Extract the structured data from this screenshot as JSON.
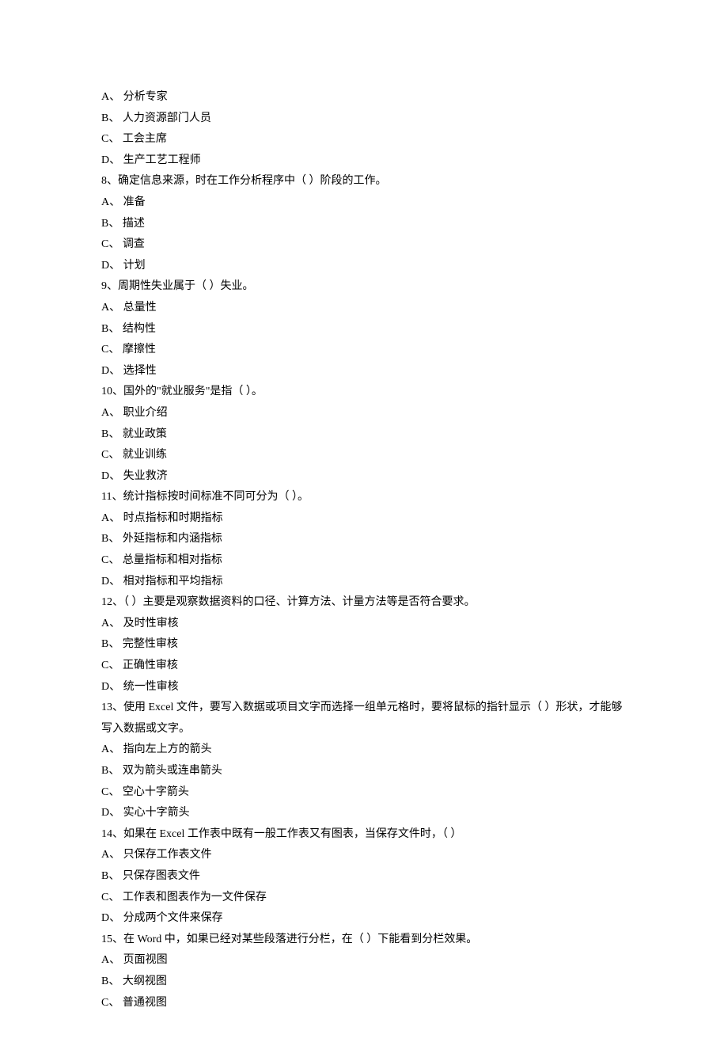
{
  "lines": [
    "A、  分析专家",
    "B、  人力资源部门人员",
    "C、  工会主席",
    "D、  生产工艺工程师",
    "8、确定信息来源，时在工作分析程序中（  ）阶段的工作。",
    "A、  准备",
    "B、  描述",
    "C、  调查",
    "D、  计划",
    "9、周期性失业属于（  ）失业。",
    "A、  总量性",
    "B、  结构性",
    "C、  摩擦性",
    "D、  选择性",
    "10、国外的\"就业服务\"是指（  ）。",
    "A、  职业介绍",
    "B、  就业政策",
    "C、  就业训练",
    "D、  失业救济",
    "11、统计指标按时间标准不同可分为（  ）。",
    "A、  时点指标和时期指标",
    "B、  外延指标和内涵指标",
    "C、  总量指标和相对指标",
    "D、  相对指标和平均指标",
    "12、（  ）主要是观察数据资料的口径、计算方法、计量方法等是否符合要求。",
    "A、  及时性审核",
    "B、  完整性审核",
    "C、  正确性审核",
    "D、  统一性审核",
    "13、使用 Excel 文件，要写入数据或项目文字而选择一组单元格时，要将鼠标的指针显示（  ）形状，才能够写入数据或文字。",
    "A、  指向左上方的箭头",
    "B、  双为箭头或连串箭头",
    "C、  空心十字箭头",
    "D、  实心十字箭头",
    "14、如果在 Excel 工作表中既有一般工作表又有图表，当保存文件时，（  ）",
    "A、  只保存工作表文件",
    "B、  只保存图表文件",
    "C、  工作表和图表作为一文件保存",
    "D、  分成两个文件来保存",
    "15、在 Word 中，如果已经对某些段落进行分栏，在（  ）下能看到分栏效果。",
    "A、  页面视图",
    "B、  大纲视图",
    "C、  普通视图"
  ]
}
